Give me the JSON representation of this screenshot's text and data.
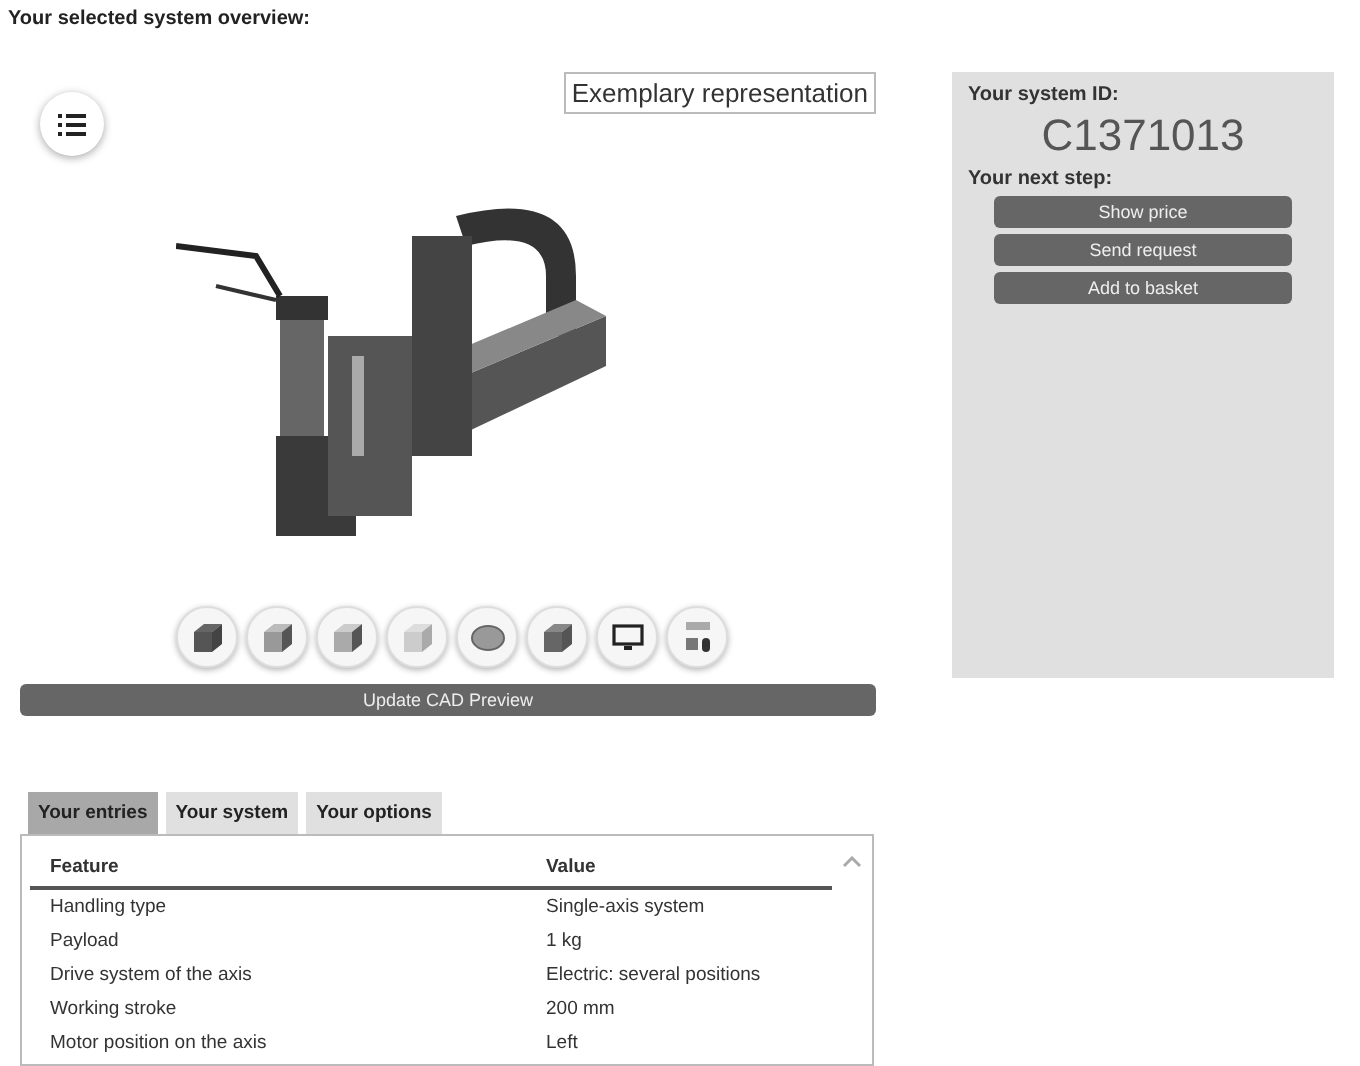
{
  "subtitle": "Your selected system overview:",
  "preview": {
    "caption": "Exemplary representation",
    "update_button": "Update CAD Preview"
  },
  "summary": {
    "id_label": "Your system ID:",
    "system_id": "C1371013",
    "next_label": "Your next step:",
    "actions": [
      "Show price",
      "Send request",
      "Add to basket"
    ]
  },
  "tabs": [
    {
      "label": "Your entries",
      "selected": true
    },
    {
      "label": "Your system",
      "selected": false
    },
    {
      "label": "Your options",
      "selected": false
    }
  ],
  "table": {
    "columns": [
      "Feature",
      "Value"
    ],
    "rows": [
      [
        "Handling type",
        "Single-axis system"
      ],
      [
        "Payload",
        "1 kg"
      ],
      [
        "Drive system of the axis",
        "Electric: several positions"
      ],
      [
        "Working stroke",
        "200 mm"
      ],
      [
        "Motor position on the axis",
        "Left"
      ]
    ]
  }
}
